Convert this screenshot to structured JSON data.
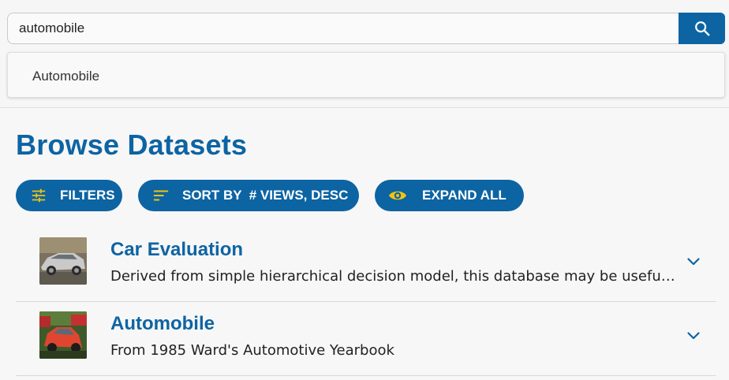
{
  "search": {
    "value": "automobile",
    "suggestions": [
      "Automobile"
    ]
  },
  "page": {
    "title": "Browse Datasets"
  },
  "toolbar": {
    "filters_label": "FILTERS",
    "sort_label": "SORT BY  # VIEWS, DESC",
    "expand_label": "EXPAND ALL",
    "filters_icon": "tune-icon",
    "sort_icon": "sort-icon",
    "expand_icon": "eye-icon"
  },
  "datasets": [
    {
      "title": "Car Evaluation",
      "description": "Derived from simple hierarchical decision model, this database may be useful for testing constructive induction and structure discovery methods.",
      "thumbnail": "silver-sedan-photo"
    },
    {
      "title": "Automobile",
      "description": "From 1985 Ward's Automotive Yearbook",
      "thumbnail": "red-cars-photo"
    }
  ],
  "colors": {
    "brand": "#0d64a3",
    "icon_accent": "#f2c40e"
  }
}
